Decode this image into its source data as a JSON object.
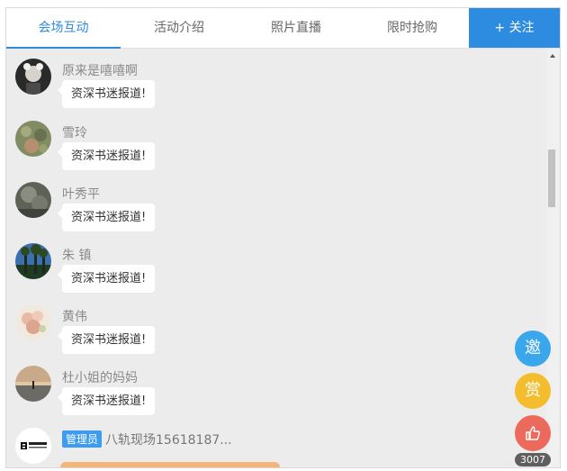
{
  "tabs": [
    {
      "label": "会场互动",
      "active": true
    },
    {
      "label": "活动介绍",
      "active": false
    },
    {
      "label": "照片直播",
      "active": false
    },
    {
      "label": "限时抢购",
      "active": false
    }
  ],
  "follow_button": {
    "label": "+ 关注"
  },
  "messages": [
    {
      "name": "原来是嘻嘻啊",
      "text": "资深书迷报道!"
    },
    {
      "name": "雪玲",
      "text": "资深书迷报道!"
    },
    {
      "name": "叶秀平",
      "text": "资深书迷报道!"
    },
    {
      "name": "朱 镇",
      "text": "资深书迷报道!"
    },
    {
      "name": "黄伟",
      "text": "资深书迷报道!"
    },
    {
      "name": "杜小姐的妈妈",
      "text": "资深书迷报道!"
    }
  ],
  "admin_message": {
    "badge": "管理员",
    "name": "八轨现场15618187..."
  },
  "floating": {
    "invite": "邀",
    "reward": "赏",
    "like_count": "3007"
  },
  "colors": {
    "accent": "#2d8be0",
    "invite": "#3aa6ec",
    "reward": "#f3bd2e",
    "like": "#ec6a5c"
  }
}
